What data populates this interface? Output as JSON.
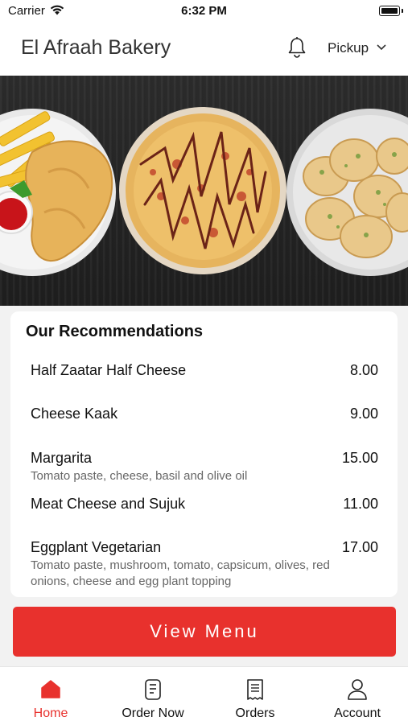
{
  "status_bar": {
    "carrier": "Carrier",
    "time": "6:32 PM"
  },
  "header": {
    "title": "El Afraah Bakery",
    "mode_label": "Pickup"
  },
  "recommendations": {
    "title": "Our Recommendations",
    "items": [
      {
        "name": "Half Zaatar Half Cheese",
        "price": "8.00",
        "description": ""
      },
      {
        "name": "Cheese Kaak",
        "price": "9.00",
        "description": ""
      },
      {
        "name": "Margarita",
        "price": "15.00",
        "description": "Tomato paste, cheese, basil and olive oil"
      },
      {
        "name": "Meat Cheese and Sujuk",
        "price": "11.00",
        "description": ""
      },
      {
        "name": "Eggplant Vegetarian",
        "price": "17.00",
        "description": "Tomato paste, mushroom, tomato, capsicum, olives, red onions, cheese and egg plant topping"
      }
    ]
  },
  "cta": {
    "label": "View Menu"
  },
  "tab_bar": {
    "tabs": [
      {
        "label": "Home",
        "icon": "home-icon",
        "active": true
      },
      {
        "label": "Order Now",
        "icon": "order-icon",
        "active": false
      },
      {
        "label": "Orders",
        "icon": "receipt-icon",
        "active": false
      },
      {
        "label": "Account",
        "icon": "person-icon",
        "active": false
      }
    ]
  },
  "colors": {
    "accent": "#e8312d",
    "text": "#111111",
    "muted": "#666666"
  }
}
